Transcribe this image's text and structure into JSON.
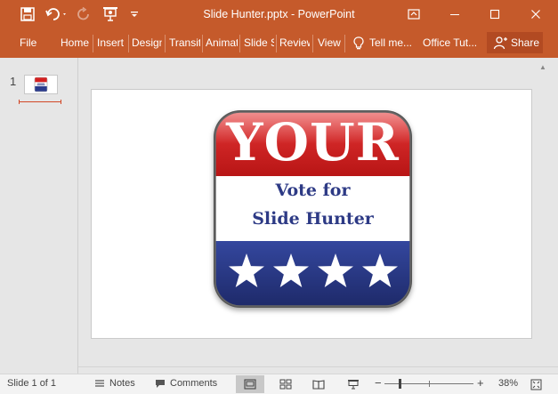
{
  "window": {
    "title": "Slide Hunter.pptx - PowerPoint",
    "accent_color": "#c55a2b"
  },
  "quick_access": [
    {
      "name": "save-icon"
    },
    {
      "name": "undo-icon"
    },
    {
      "name": "redo-icon"
    },
    {
      "name": "start-from-beginning-icon"
    },
    {
      "name": "customize-toolbar-icon"
    }
  ],
  "ribbon": {
    "file_label": "File",
    "tabs": [
      "Home",
      "Insert",
      "Design",
      "Transitions",
      "Animations",
      "Slide Show",
      "Review",
      "View"
    ],
    "tell_me": "Tell me...",
    "office_tutorials": "Office Tut...",
    "share_label": "Share"
  },
  "thumbnails": [
    {
      "number": "1"
    }
  ],
  "slide": {
    "badge_top_text": "YOUR",
    "badge_line1": "Vote for",
    "badge_line2": "Slide Hunter",
    "star_count": 4,
    "colors": {
      "red": "#d42020",
      "white": "#ffffff",
      "blue": "#2a3a8c",
      "text_blue": "#2d3a85"
    }
  },
  "status": {
    "slide_info": "Slide 1 of 1",
    "notes_label": "Notes",
    "comments_label": "Comments",
    "zoom_percent": "38%",
    "zoom_minus": "−",
    "zoom_plus": "+"
  }
}
